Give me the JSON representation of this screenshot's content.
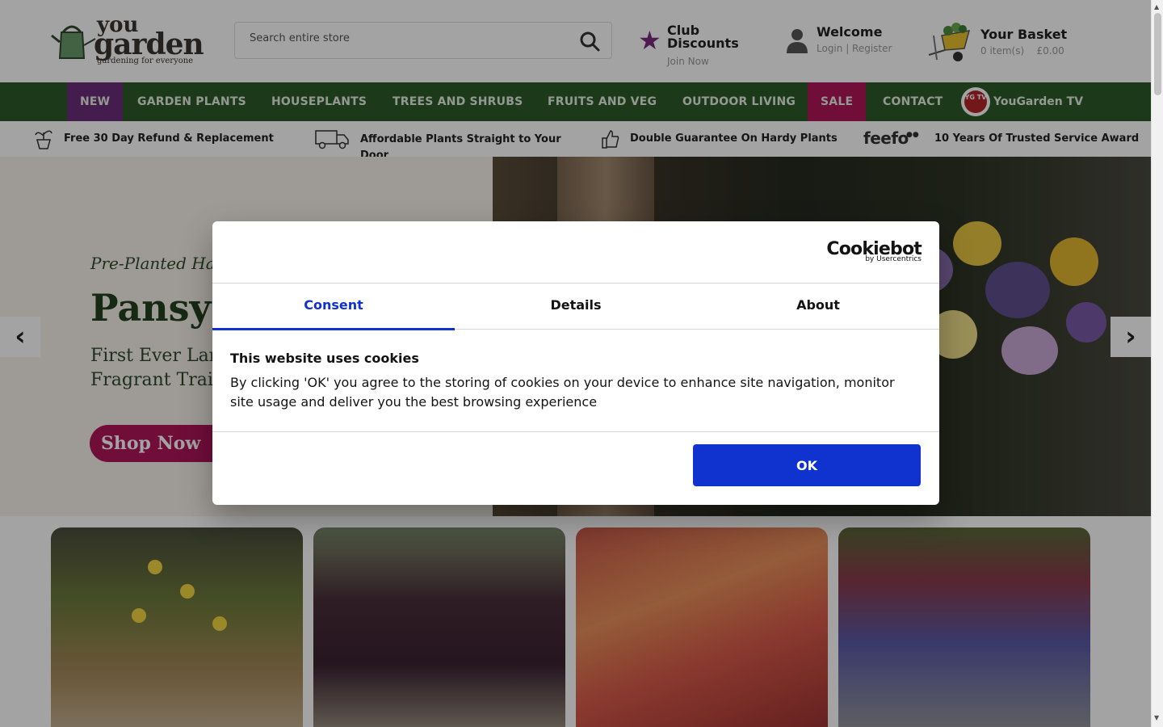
{
  "header": {
    "logo": {
      "you": "you",
      "garden": "garden",
      "tagline": "gardening for everyone"
    },
    "search": {
      "placeholder": "Search entire store"
    },
    "club": {
      "title": "Club Discounts",
      "link": "Join Now"
    },
    "account": {
      "title": "Welcome",
      "links": "Login | Register"
    },
    "basket": {
      "title": "Your Basket",
      "items": "0 item(s)",
      "total": "£0.00"
    }
  },
  "nav": {
    "items": [
      "NEW",
      "GARDEN PLANTS",
      "HOUSEPLANTS",
      "TREES AND SHRUBS",
      "FRUITS AND VEG",
      "OUTDOOR LIVING",
      "SALE",
      "CONTACT"
    ],
    "tv_badge": "YG TV",
    "tv_label": "YouGarden TV",
    "colors": {
      "bar": "#2d5b2a",
      "new": "#6d2d7a",
      "sale": "#b0155a"
    }
  },
  "usp": {
    "items": [
      {
        "icon": "plant-pot-icon",
        "text": "Free 30 Day Refund & Replacement"
      },
      {
        "icon": "delivery-truck-icon",
        "text": "Affordable Plants Straight to Your Door"
      },
      {
        "icon": "thumbs-up-icon",
        "text": "Double Guarantee On Hardy Plants"
      },
      {
        "icon": "feefo-logo",
        "brand": "feefo",
        "text": "10 Years Of Trusted Service Award"
      }
    ]
  },
  "hero": {
    "subtitle": "Pre-Planted Ha",
    "title": "Pansy",
    "desc_line1": "First Ever Lar",
    "desc_line2": "Fragrant Trai",
    "button": "Shop Now"
  },
  "cookie_dialog": {
    "brand": "Cookiebot",
    "brand_sub": "by Usercentrics",
    "tabs": [
      "Consent",
      "Details",
      "About"
    ],
    "active_tab": "Consent",
    "title": "This website uses cookies",
    "body": "By clicking 'OK' you agree to the storing of cookies on your device to enhance site navigation, monitor site usage and deliver you the best browsing experience",
    "ok_label": "OK",
    "accent": "#1032cf"
  }
}
